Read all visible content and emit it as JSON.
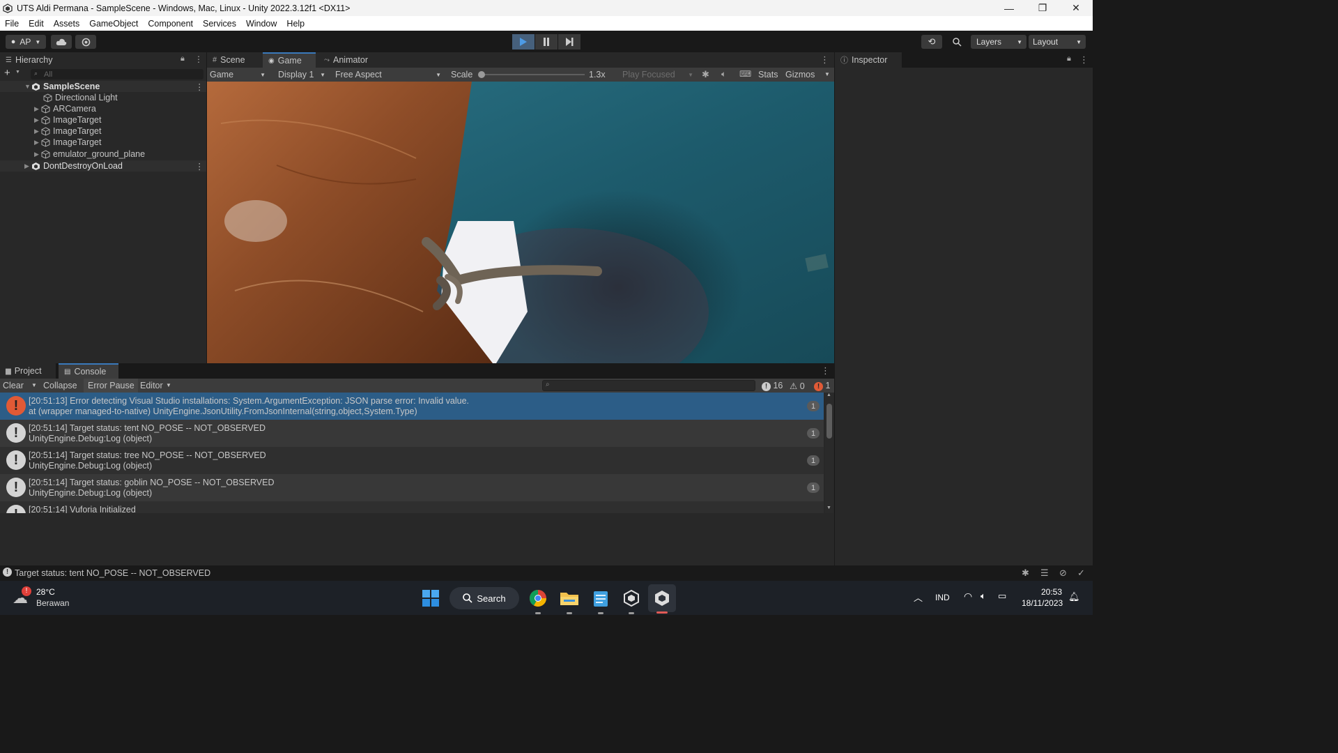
{
  "window": {
    "title": "UTS Aldi Permana - SampleScene - Windows, Mac, Linux - Unity 2022.3.12f1 <DX11>",
    "minimize": "—",
    "maximize": "❐",
    "close": "✕"
  },
  "menu": [
    "File",
    "Edit",
    "Assets",
    "GameObject",
    "Component",
    "Services",
    "Window",
    "Help"
  ],
  "toolbar": {
    "account": "AP",
    "layers": "Layers",
    "layout": "Layout"
  },
  "hierarchy": {
    "tab": "Hierarchy",
    "search_placeholder": "All",
    "scene": "SampleScene",
    "items": [
      "Directional Light",
      "ARCamera",
      "ImageTarget",
      "ImageTarget",
      "ImageTarget",
      "emulator_ground_plane"
    ],
    "dontdestroy": "DontDestroyOnLoad"
  },
  "view_tabs": {
    "scene": "Scene",
    "game": "Game",
    "animator": "Animator"
  },
  "game_toolbar": {
    "mode": "Game",
    "display": "Display 1",
    "aspect": "Free Aspect",
    "scale_label": "Scale",
    "scale_value": "1.3x",
    "play_focused": "Play Focused",
    "stats": "Stats",
    "gizmos": "Gizmos"
  },
  "inspector": {
    "tab": "Inspector"
  },
  "bottom_tabs": {
    "project": "Project",
    "console": "Console"
  },
  "console_toolbar": {
    "clear": "Clear",
    "collapse": "Collapse",
    "error_pause": "Error Pause",
    "editor": "Editor",
    "log_count": "16",
    "warn_count": "0",
    "error_count": "1"
  },
  "console": [
    {
      "type": "error",
      "line1": "[20:51:13] Error detecting Visual Studio installations: System.ArgumentException: JSON parse error: Invalid value.",
      "line2": " at (wrapper managed-to-native) UnityEngine.JsonUtility.FromJsonInternal(string,object,System.Type)",
      "count": "1"
    },
    {
      "type": "log",
      "line1": "[20:51:14] Target status: tent NO_POSE -- NOT_OBSERVED",
      "line2": "UnityEngine.Debug:Log (object)",
      "count": "1"
    },
    {
      "type": "log",
      "line1": "[20:51:14] Target status: tree NO_POSE -- NOT_OBSERVED",
      "line2": "UnityEngine.Debug:Log (object)",
      "count": "1"
    },
    {
      "type": "log",
      "line1": "[20:51:14] Target status: goblin NO_POSE -- NOT_OBSERVED",
      "line2": "UnityEngine.Debug:Log (object)",
      "count": "1"
    },
    {
      "type": "log",
      "line1": "[20:51:14] Vuforia Initialized",
      "line2": "",
      "count": ""
    }
  ],
  "statusbar": {
    "message": "Target status: tent NO_POSE -- NOT_OBSERVED"
  },
  "taskbar": {
    "weather_temp": "28°C",
    "weather_desc": "Berawan",
    "search": "Search",
    "lang": "IND",
    "time": "20:53",
    "date": "18/11/2023"
  },
  "colors": {
    "accent": "#3a79bb",
    "selected_row": "#2c5d87",
    "error_icon": "#e05a36"
  }
}
